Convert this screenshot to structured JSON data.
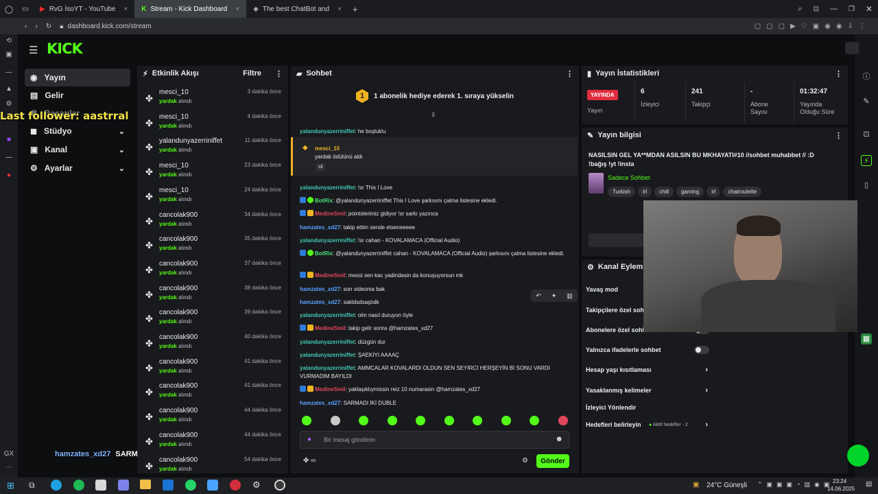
{
  "browser": {
    "tabs": [
      {
        "label": "RvG İsoYT - YouTube"
      },
      {
        "label": "Stream - Kick Dashboard"
      },
      {
        "label": "The best ChatBot and"
      }
    ],
    "url": "dashboard.kick.com/stream"
  },
  "logo": "KICK",
  "overlay": {
    "last_follower": "Last follower: aastrral",
    "chat_user": "hamzates_xd27",
    "chat_text": "SARMADI İKİ DUBLE"
  },
  "sidenav": {
    "items": [
      {
        "label": "Yayın"
      },
      {
        "label": "Gelir"
      },
      {
        "label": "Başarılar"
      },
      {
        "label": "Stüdyo"
      },
      {
        "label": "Kanal"
      },
      {
        "label": "Ayarlar"
      }
    ]
  },
  "activity": {
    "title": "Etkinlik Akışı",
    "filter": "Filtre",
    "items": [
      {
        "user": "mesci_10",
        "reward": "yardak",
        "action": "alındı",
        "time": "3 dakika önce"
      },
      {
        "user": "mesci_10",
        "reward": "yardak",
        "action": "alındı",
        "time": "4 dakika önce"
      },
      {
        "user": "yalandunyazerriniffet",
        "reward": "yardak",
        "action": "alındı",
        "time": "11 dakika önce"
      },
      {
        "user": "mesci_10",
        "reward": "yardak",
        "action": "alındı",
        "time": "23 dakika önce"
      },
      {
        "user": "mesci_10",
        "reward": "yardak",
        "action": "alındı",
        "time": "24 dakika önce"
      },
      {
        "user": "cancolak900",
        "reward": "yardak",
        "action": "alındı",
        "time": "34 dakika önce"
      },
      {
        "user": "cancolak900",
        "reward": "yardak",
        "action": "alındı",
        "time": "35 dakika önce"
      },
      {
        "user": "cancolak900",
        "reward": "yardak",
        "action": "alındı",
        "time": "37 dakika önce"
      },
      {
        "user": "cancolak900",
        "reward": "yardak",
        "action": "alındı",
        "time": "38 dakika önce"
      },
      {
        "user": "cancolak900",
        "reward": "yardak",
        "action": "alındı",
        "time": "39 dakika önce"
      },
      {
        "user": "cancolak900",
        "reward": "yardak",
        "action": "alındı",
        "time": "40 dakika önce"
      },
      {
        "user": "cancolak900",
        "reward": "yardak",
        "action": "alındı",
        "time": "41 dakika önce"
      },
      {
        "user": "cancolak900",
        "reward": "yardak",
        "action": "alındı",
        "time": "41 dakika önce"
      },
      {
        "user": "cancolak900",
        "reward": "yardak",
        "action": "alındı",
        "time": "44 dakika önce"
      },
      {
        "user": "cancolak900",
        "reward": "yardak",
        "action": "alındı",
        "time": "44 dakika önce"
      },
      {
        "user": "cancolak900",
        "reward": "yardak",
        "action": "alındı",
        "time": "54 dakika önce"
      }
    ]
  },
  "chat": {
    "title": "Sohbet",
    "gift_count": "1",
    "gift_text": "1 abonelik hediye ederek 1. sıraya yükselin",
    "tip": {
      "user": "mesci_10",
      "text": "yardak ödülünü aldı",
      "sub": "sil"
    },
    "messages": [
      {
        "user": "yalandunyazerriniffet",
        "text": "he boşluklu",
        "color": "uteal"
      },
      {
        "user": "yalandunyazerriniffet",
        "text": "!sr This I Love",
        "color": "uteal"
      },
      {
        "user": "BotRix",
        "text": "@yalandunyazerriniffet This I Love şarkısını çalma listesine ekledi.",
        "color": "ugreen"
      },
      {
        "user": "MedineSmil",
        "text": "pointslerimiz gidiyor !sr sarkı yazınca",
        "color": "ured"
      },
      {
        "user": "hamzates_xd27",
        "text": "takip ettim sende etseneeeee",
        "color": "ublue"
      },
      {
        "user": "yalandunyazerriniffet",
        "text": "!sr cahan - KOVALAMACA (Official Audio)",
        "color": "uteal"
      },
      {
        "user": "BotRix",
        "text": "@yalandunyazerriniffet cahan - KOVALAMACA (Official Audio) şarkısını çalma listesine ekledi.",
        "color": "ugreen"
      },
      {
        "user": "MedineSmil",
        "text": "messi sen kac yadindasin da konuşuyorsun mk",
        "color": "ured"
      },
      {
        "user": "hamzates_xd27",
        "text": "son videoma bak",
        "color": "ublue"
      },
      {
        "user": "hamzates_xd27",
        "text": "sakldsdsaşlıdk",
        "color": "ublue"
      },
      {
        "user": "yalandunyazerriniffet",
        "text": "olm nasıl duruyon öyle",
        "color": "uteal"
      },
      {
        "user": "MedineSmil",
        "text": "takip gelir sonra @hamzates_xd27",
        "color": "ured"
      },
      {
        "user": "yalandunyazerriniffet",
        "text": "düzgün dur",
        "color": "uteal"
      },
      {
        "user": "yalandunyazerriniffet",
        "text": "ŞAEKIYI AAAAÇ",
        "color": "uteal"
      },
      {
        "user": "yalandunyazerriniffet",
        "text": "AMMCALAR KOVALARDI OLDUN SEN SEYİRCİ HERŞEYİN Bİ SONU VARDI VURMADIM BAYILDI",
        "color": "uteal"
      },
      {
        "user": "MedineSmil",
        "text": "yaklaşıklıymissin reiz 10 numarasin @hamzates_xd27",
        "color": "ured"
      },
      {
        "user": "hamzates_xd27",
        "text": "SARMADI İKİ DUBLE",
        "color": "ublue"
      }
    ],
    "input_placeholder": "Bir mesaj gönderin",
    "send_label": "Gönder",
    "points": "∞"
  },
  "stats": {
    "title": "Yayın İstatistikleri",
    "live_label": "YAYINDA",
    "live_sub": "Yayın",
    "viewers": "6",
    "viewers_label": "İzleyici",
    "followers": "241",
    "followers_label": "Takipçi",
    "subs": "-",
    "subs_label": "Abone Sayısı",
    "uptime": "01:32:47",
    "uptime_label": "Yayında Olduğu Süre"
  },
  "streaminfo": {
    "title": "Yayın bilgisi",
    "stream_title": "NASILSIN GEL YA**MDAN ASILSIN BU MKHAYATI#10 //sohbet muhabbet // :D !bağış !yt !insta",
    "category": "Sadece Sohbet",
    "tags": [
      "Turkish",
      "irl",
      "chill",
      "gaming",
      "irl",
      "chatroulette"
    ]
  },
  "actions": {
    "title": "Kanal Eylemleri",
    "rows": [
      {
        "label": "Yavaş mod"
      },
      {
        "label": "Takipçilere özel sohbet"
      },
      {
        "label": "Abonelere özel sohbet"
      },
      {
        "label": "Yalnızca ifadelerle sohbet"
      },
      {
        "label": "Hesap yaşı kısıtlaması"
      },
      {
        "label": "Yasaklanmış kelimeler"
      },
      {
        "label": "İzleyici Yönlendir"
      },
      {
        "label": "Hedefleri belirleyin"
      }
    ],
    "goals_status": "Aktif hedefler - 2"
  },
  "taskbar": {
    "weather": "24°C Güneşli",
    "time": "23:24",
    "date": "14.06.2025"
  }
}
